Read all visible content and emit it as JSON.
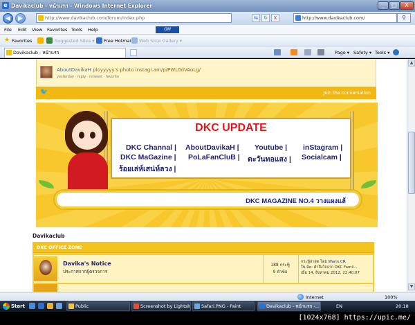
{
  "window": {
    "title": "Davikaclub - หน้าแรก - Windows Internet Explorer",
    "minimize": "_",
    "maximize": "□",
    "close": "X"
  },
  "nav": {
    "back": "◀",
    "forward": "▶",
    "url": "http://www.davikaclub.com/forum/index.php",
    "refresh": "↻",
    "compat": "⇆",
    "stop": "X",
    "search_value": "http://www.davikaclub.com/",
    "search_btn": "⚲"
  },
  "menu": {
    "items": [
      "File",
      "Edit",
      "View",
      "Favorites",
      "Tools",
      "Help"
    ],
    "brand": "GM"
  },
  "favorites_bar": {
    "favorites_label": "Favorites",
    "suggested_sites": "Suggested Sites ▾",
    "free_hotmail": "Free Hotmail",
    "web_slice": "Web Slice Gallery ▾"
  },
  "tabs": {
    "active_tab": "Davikaclub - หน้าแรก",
    "commands": [
      "Page ▾",
      "Safety ▾",
      "Tools ▾"
    ]
  },
  "tweet": {
    "user": "AboutDavikaH",
    "text": "ployyyyy's photo",
    "link": "instagr.am/p/PWL0dVAoLg/",
    "meta": "yesterday · reply · retweet · favorite",
    "bird": "🐦",
    "join": "Join the conversation"
  },
  "banner": {
    "title": "DKC UPDATE",
    "links": [
      "DKC Channal |",
      "AboutDavikaH |",
      "Youtube |",
      "inStagram |",
      "DKC MaGazine |",
      "PoLaFanCluB |",
      "ตะวันทอแสง |",
      "Socialcam |",
      "ร้อยเล่ห์เสน่ห์ลวง |"
    ],
    "magazine": "DKC MAGAZINE NO.4 วางแผงแล้"
  },
  "forum": {
    "section_title": "Davikaclub",
    "zone_title": "DKC OFFICE ZONE",
    "row": {
      "name": "Davika's Notice",
      "desc": "ประกาศจากผู้ตรวจการ",
      "posts": "188 กระทู้",
      "topics": "9 หัวข้อ",
      "last_line1_prefix": "กระทู้ล่าสุด โดย",
      "last_by": "Warin.CR",
      "last_line2": "ใน Re: คำถึงใจจาก DKC Famil...",
      "last_line3": "เมื่อ 14, สิงหาคม 2012, 22:40:07"
    }
  },
  "statusbar": {
    "zone": "Internet",
    "zoom": "100%"
  },
  "taskbar": {
    "start": "Start",
    "items": [
      "Public",
      "Screenshot by Lightsh...",
      "Safari.PNG - Paint",
      "Davikaclub - หน้าแรก -..."
    ],
    "lang": "EN",
    "time": "20:18"
  },
  "caption": "[1024x768] https://upic.me/"
}
